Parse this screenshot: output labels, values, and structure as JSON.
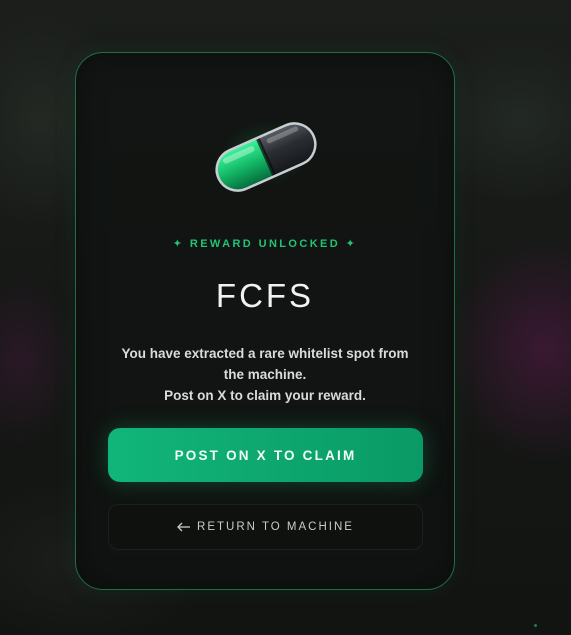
{
  "modal": {
    "kicker": "✦ REWARD UNLOCKED ✦",
    "title": "FCFS",
    "description_lines": [
      "You have extracted a rare whitelist spot from",
      "the machine.",
      "Post on X to claim your reward."
    ],
    "primary_button_label": "POST ON X TO CLAIM",
    "secondary_button_label": "RETURN TO MACHINE",
    "secondary_button_icon": "arrow-left-icon",
    "reward_icon": "pill-capsule-icon"
  },
  "colors": {
    "accent": "#22c373",
    "button_green": "#11b57a",
    "modal_border": "#1f6e45",
    "background": "#141614"
  }
}
